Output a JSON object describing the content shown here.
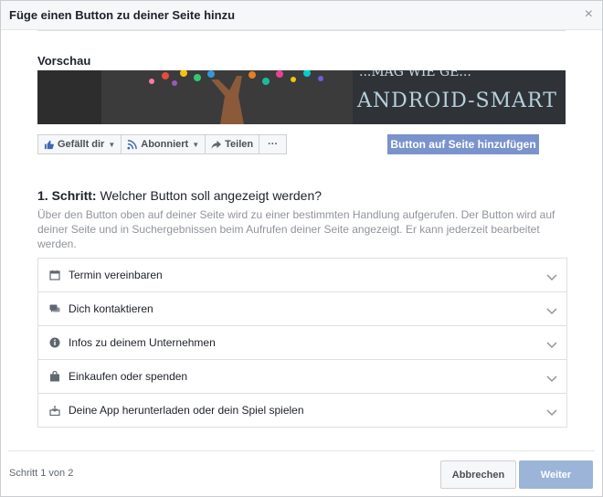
{
  "dialog": {
    "title": "Füge einen Button zu deiner Seite hinzu",
    "close_symbol": "×"
  },
  "preview": {
    "label": "Vorschau",
    "cover_text": "ANDROID-SMART",
    "cover_text_top": "...MAG WIE GE..."
  },
  "action_bar": {
    "like": "Gefällt dir",
    "follow": "Abonniert",
    "share": "Teilen",
    "more": "···"
  },
  "add_button_label": "Button auf Seite hinzufügen",
  "step": {
    "number": "1. Schritt:",
    "question": "Welcher Button soll angezeigt werden?",
    "description": "Über den Button oben auf deiner Seite wird zu einer bestimmten Handlung aufgerufen. Der Button wird auf deiner Seite und in Suchergebnissen beim Aufrufen deiner Seite angezeigt. Er kann jederzeit bearbeitet werden."
  },
  "options": [
    {
      "label": "Termin vereinbaren",
      "icon": "calendar-icon"
    },
    {
      "label": "Dich kontaktieren",
      "icon": "chat-bubbles-icon"
    },
    {
      "label": "Infos zu deinem Unternehmen",
      "icon": "info-icon"
    },
    {
      "label": "Einkaufen oder spenden",
      "icon": "shopping-bag-icon"
    },
    {
      "label": "Deine App herunterladen oder dein Spiel spielen",
      "icon": "download-icon"
    }
  ],
  "footer": {
    "step_count": "Schritt 1 von 2",
    "cancel": "Abbrechen",
    "next": "Weiter"
  },
  "colors": {
    "primary": "#4267b2",
    "add_button": "#7b93cc",
    "next_button_disabled": "#9cb4d8"
  }
}
